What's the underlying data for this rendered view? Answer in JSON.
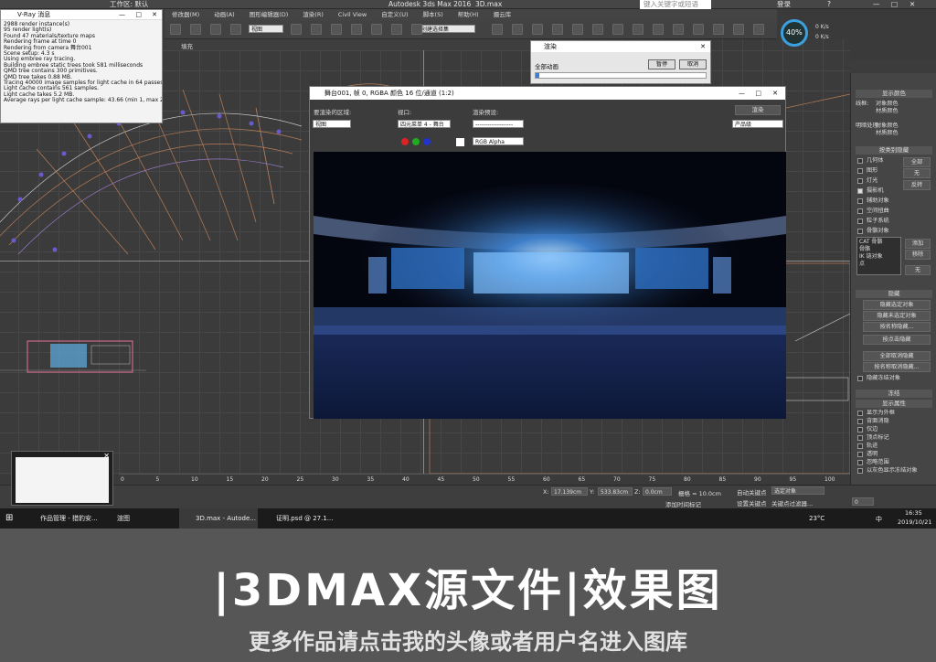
{
  "app": {
    "title": "Autodesk 3ds Max 2016",
    "file": "3D.max",
    "workspace": "工作区: 默认",
    "search_placeholder": "键入关键字或短语",
    "login": "登录"
  },
  "menu": [
    "修改器(M)",
    "动画(A)",
    "图形编辑器(D)",
    "渲染(R)",
    "Civil View",
    "自定义(U)",
    "脚本(S)",
    "帮助(H)",
    "摄云库"
  ],
  "toolbar": {
    "view_select": "视图",
    "selection_set": "创建选择集",
    "fill_label": "填充"
  },
  "perf": {
    "percent": "40%",
    "net_up": "0 K/s",
    "net_down": "0 K/s"
  },
  "vray": {
    "title": "V-Ray 消息",
    "log": [
      "2988 render instance(s)",
      "95 render light(s)",
      "Found 47 materials/texture maps",
      "Rendering frame at time 0",
      "Rendering from camera 舞台001",
      "Scene setup: 4.3 s",
      "Using embree ray tracing.",
      "Building embree static trees took 581 milliseconds",
      "QMD tree contains 300 primitives.",
      "QMD tree takes 0.88 MB.",
      "Tracing 40000 image samples for light cache in 64 passes.",
      "Light cache contains 561 samples.",
      "Light cache takes 5.2 MB.",
      "Average rays per light cache sample: 43.66 (min 1, max 283)"
    ]
  },
  "render_progress": {
    "title": "渲染",
    "all_anim": "全部动画",
    "pause": "暂停",
    "cancel": "取消",
    "progress": 0.02
  },
  "frame_buffer": {
    "title": "舞台001, 帧 0, RGBA 颜色 16 位/通道 (1:2)",
    "area_label": "要渲染的区域:",
    "area_value": "视图",
    "viewport_label": "视口:",
    "viewport_value": "四元菜单 4 - 舞台",
    "preset_label": "渲染预设:",
    "preset_value": "-------------------",
    "render_button": "渲染",
    "product_value": "产品级",
    "channel_value": "RGB Alpha"
  },
  "command_panel": {
    "display_color": "显示颜色",
    "wireframe_label": "线框:",
    "obj_color": "对象颜色",
    "mat_color": "材质颜色",
    "shaded_label": "明暗处理:",
    "obj_color2": "对象颜色",
    "mat_color2": "材质颜色",
    "hide_by_category": "按类别隐藏",
    "categories": [
      "几何体",
      "图形",
      "灯光",
      "摄影机",
      "辅助对象",
      "空间扭曲",
      "粒子系统",
      "骨骼对象"
    ],
    "all": "全部",
    "none": "无",
    "invert": "反转",
    "list_items": [
      "CAT 骨骼",
      "骨骼",
      "IK 链对象",
      "点"
    ],
    "add": "添加",
    "remove": "移除",
    "none2": "无",
    "hide": "隐藏",
    "hide_selected": "隐藏选定对象",
    "hide_unselected": "隐藏未选定对象",
    "hide_by_name": "按名称隐藏...",
    "hide_by_click": "按点击隐藏",
    "unhide_all": "全部取消隐藏",
    "unhide_by_name": "按名称取消隐藏...",
    "hide_frozen": "隐藏冻结对象",
    "freeze": "冻结",
    "display_props": "显示属性",
    "props": [
      "显示为外框",
      "背面消隐",
      "仅边",
      "顶点标记",
      "轨迹",
      "透明",
      "忽略范围",
      "以灰色显示冻结对象"
    ]
  },
  "timeline": {
    "ticks": [
      "0",
      "5",
      "10",
      "15",
      "20",
      "25",
      "30",
      "35",
      "40",
      "45",
      "50",
      "55",
      "60",
      "65",
      "70",
      "75",
      "80",
      "85",
      "90",
      "95",
      "100"
    ]
  },
  "status": {
    "x_label": "X:",
    "x": "17.139cm",
    "y_label": "Y:",
    "y": "533.83cm",
    "z_label": "Z:",
    "z": "0.0cm",
    "grid": "栅格 = 10.0cm",
    "auto_key": "自动关键点",
    "selected_obj": "选定对象",
    "set_key": "设置关键点",
    "key_filters": "关键点过滤器...",
    "add_time_tag": "添加时间标记",
    "frame": "0"
  },
  "taskbar": {
    "items": [
      "作品管理 - 猎豹安...",
      "渲图",
      "3D.max - Autode...",
      "证明.psd @ 27.1..."
    ],
    "temp": "23°C",
    "ime": "中",
    "time": "16:35",
    "date": "2019/10/21"
  },
  "banner": {
    "title": "|3DMAX源文件|效果图",
    "subtitle": "更多作品请点击我的头像或者用户名进入图库"
  }
}
